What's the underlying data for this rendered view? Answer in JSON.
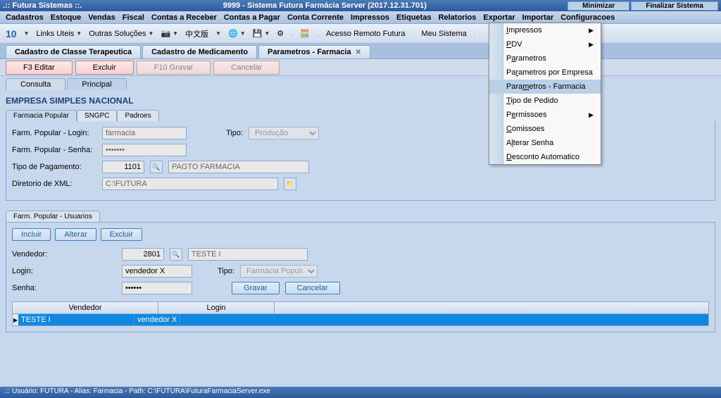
{
  "titlebar": {
    "app_name": ".:: Futura Sistemas ::.",
    "window_title": "9999 - Sistema Futura Farmácia Server (2017.12.31.701)",
    "minimize": "Minimizar",
    "close": "Finalizar Sistema"
  },
  "menubar": {
    "items": [
      "Cadastros",
      "Estoque",
      "Vendas",
      "Fiscal",
      "Contas a Receber",
      "Contas a Pagar",
      "Conta Corrente",
      "Impressos",
      "Etiquetas",
      "Relatorios",
      "Exportar",
      "Importar",
      "Configuracoes"
    ]
  },
  "toolbar": {
    "logo": "10",
    "links_uteis": "Links Uteis",
    "outras_solucoes": "Outras Soluções",
    "lang": "中文版",
    "acesso_remoto": "Acesso Remoto Futura",
    "meu_sistema": "Meu Sistema"
  },
  "tabs": [
    {
      "label": "Cadastro de Classe Terapeutica"
    },
    {
      "label": "Cadastro de Medicamento"
    },
    {
      "label": "Parametros - Farmacia"
    }
  ],
  "actions": {
    "editar": "F3 Editar",
    "excluir": "Excluir",
    "gravar": "F10 Gravar",
    "cancelar": "Cancelar"
  },
  "inner_tabs": {
    "consulta": "Consulta",
    "principal": "Principal"
  },
  "section_title": "EMPRESA SIMPLES NACIONAL",
  "sub_tabs": {
    "farmacia_popular": "Farmacia Popular",
    "sngpc": "SNGPC",
    "padroes": "Padroes"
  },
  "form": {
    "login_label": "Farm. Popular - Login:",
    "login_value": "farmacia",
    "senha_label": "Farm. Popular - Senha:",
    "senha_value": "•••••••",
    "tipo_label": "Tipo:",
    "tipo_value": "Produção",
    "pagamento_label": "Tipo de Pagamento:",
    "pagamento_code": "1101",
    "pagamento_desc": "PAGTO FARMACIA",
    "xml_label": "Diretorio de XML:",
    "xml_value": "C:\\FUTURA"
  },
  "users_section": {
    "title": "Farm. Popular - Usuarios",
    "btn_incluir": "Incluir",
    "btn_alterar": "Alterar",
    "btn_excluir": "Excluir",
    "vendedor_label": "Vendedor:",
    "vendedor_code": "2801",
    "vendedor_name": "TESTE I",
    "login_label": "Login:",
    "login_value": "vendedor X",
    "tipo_label": "Tipo:",
    "tipo_value": "Farmácia Popular",
    "senha_label": "Senha:",
    "senha_value": "••••••",
    "btn_gravar": "Gravar",
    "btn_cancelar": "Cancelar"
  },
  "grid": {
    "headers": [
      "Vendedor",
      "Login"
    ],
    "rows": [
      {
        "vendedor": "TESTE I",
        "login": "vendedor X"
      }
    ]
  },
  "dropdown_menu": {
    "items": [
      {
        "label_pre": "",
        "label_u": "I",
        "label_post": "mpressos",
        "arrow": true
      },
      {
        "label_pre": "",
        "label_u": "P",
        "label_post": "DV",
        "arrow": true
      },
      {
        "label_pre": "P",
        "label_u": "a",
        "label_post": "rametros",
        "arrow": false
      },
      {
        "label_pre": "Pa",
        "label_u": "r",
        "label_post": "ametros por Empresa",
        "arrow": false
      },
      {
        "label_pre": "Para",
        "label_u": "m",
        "label_post": "etros - Farmacia",
        "arrow": false,
        "highlighted": true
      },
      {
        "label_pre": "",
        "label_u": "T",
        "label_post": "ipo de Pedido",
        "arrow": false
      },
      {
        "label_pre": "P",
        "label_u": "e",
        "label_post": "rmissoes",
        "arrow": true
      },
      {
        "label_pre": "",
        "label_u": "C",
        "label_post": "omissoes",
        "arrow": false
      },
      {
        "label_pre": "A",
        "label_u": "l",
        "label_post": "terar Senha",
        "arrow": false
      },
      {
        "label_pre": "",
        "label_u": "D",
        "label_post": "esconto Automatico",
        "arrow": false
      }
    ]
  },
  "statusbar": {
    "text": ".:: Usuário: FUTURA - Alias: Farmacia - Path: C:\\FUTURA\\FuturaFarmaciaServer.exe"
  }
}
